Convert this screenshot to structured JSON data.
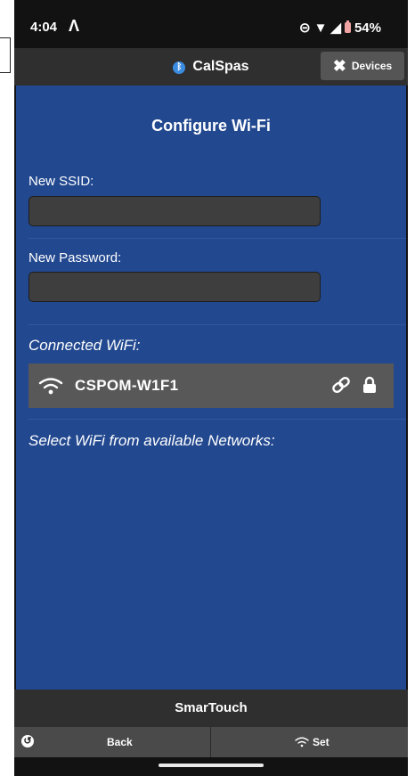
{
  "status_bar": {
    "time": "4:04",
    "battery": "54%"
  },
  "header": {
    "title": "CalSpas",
    "devices_label": "Devices"
  },
  "main": {
    "page_title": "Configure Wi-Fi",
    "ssid_label": "New SSID:",
    "ssid_value": "",
    "password_label": "New Password:",
    "password_value": "",
    "connected_label": "Connected WiFi:",
    "connected_network": "CSPOM-W1F1",
    "select_label": "Select WiFi from available Networks:"
  },
  "footer": {
    "title": "SmarTouch",
    "back_label": "Back",
    "set_label": "Set"
  }
}
